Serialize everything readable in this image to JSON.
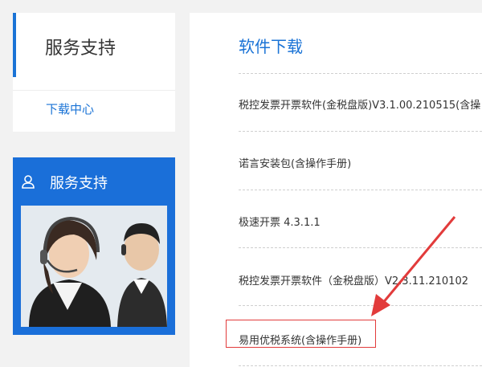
{
  "sidebar": {
    "title": "服务支持",
    "link": "下载中心"
  },
  "support_box": {
    "title": "服务支持",
    "icon": "user-icon"
  },
  "main": {
    "title": "软件下载",
    "items": [
      "税控发票开票软件(金税盘版)V3.1.00.210515(含操",
      "诺言安装包(含操作手册)",
      "极速开票 4.3.1.1",
      "税控发票开票软件（金税盘版）V2.3.11.210102",
      "易用优税系统(含操作手册)"
    ]
  },
  "colors": {
    "accent": "#1a73d6",
    "support_box": "#1a6fd9",
    "highlight": "#e23b3b"
  }
}
